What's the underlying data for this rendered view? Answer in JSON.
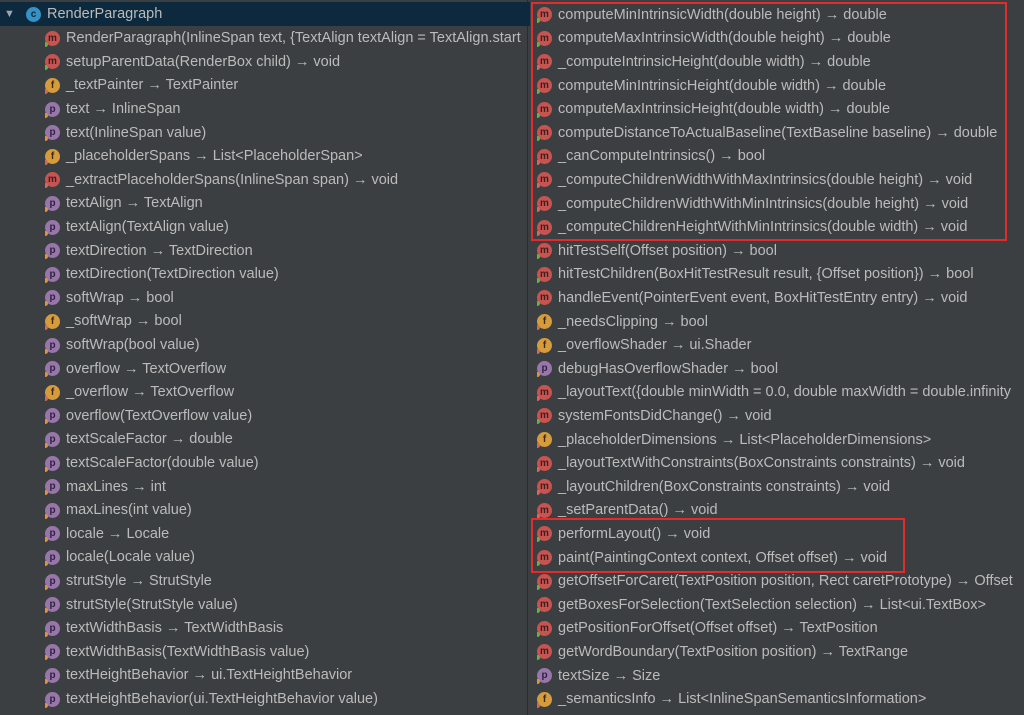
{
  "tree": {
    "class_name": "RenderParagraph",
    "left": [
      {
        "icon": "m",
        "text": "RenderParagraph(InlineSpan text, {TextAlign textAlign = TextAlign.start"
      },
      {
        "icon": "m",
        "text": "setupParentData(RenderBox child) → void"
      },
      {
        "icon": "f",
        "text": "_textPainter → TextPainter"
      },
      {
        "icon": "p",
        "text": "text → InlineSpan"
      },
      {
        "icon": "p",
        "text": "text(InlineSpan value)"
      },
      {
        "icon": "f",
        "text": "_placeholderSpans → List<PlaceholderSpan>"
      },
      {
        "icon": "m",
        "text": "_extractPlaceholderSpans(InlineSpan span) → void"
      },
      {
        "icon": "p",
        "text": "textAlign → TextAlign"
      },
      {
        "icon": "p",
        "text": "textAlign(TextAlign value)"
      },
      {
        "icon": "p",
        "text": "textDirection → TextDirection"
      },
      {
        "icon": "p",
        "text": "textDirection(TextDirection value)"
      },
      {
        "icon": "p",
        "text": "softWrap → bool"
      },
      {
        "icon": "f",
        "text": "_softWrap → bool"
      },
      {
        "icon": "p",
        "text": "softWrap(bool value)"
      },
      {
        "icon": "p",
        "text": "overflow → TextOverflow"
      },
      {
        "icon": "f",
        "text": "_overflow → TextOverflow"
      },
      {
        "icon": "p",
        "text": "overflow(TextOverflow value)"
      },
      {
        "icon": "p",
        "text": "textScaleFactor → double"
      },
      {
        "icon": "p",
        "text": "textScaleFactor(double value)"
      },
      {
        "icon": "p",
        "text": "maxLines → int"
      },
      {
        "icon": "p",
        "text": "maxLines(int value)"
      },
      {
        "icon": "p",
        "text": "locale → Locale"
      },
      {
        "icon": "p",
        "text": "locale(Locale value)"
      },
      {
        "icon": "p",
        "text": "strutStyle → StrutStyle"
      },
      {
        "icon": "p",
        "text": "strutStyle(StrutStyle value)"
      },
      {
        "icon": "p",
        "text": "textWidthBasis → TextWidthBasis"
      },
      {
        "icon": "p",
        "text": "textWidthBasis(TextWidthBasis value)"
      },
      {
        "icon": "p",
        "text": "textHeightBehavior → ui.TextHeightBehavior"
      },
      {
        "icon": "p",
        "text": "textHeightBehavior(ui.TextHeightBehavior value)"
      }
    ],
    "right": [
      {
        "icon": "m",
        "text": "computeMinIntrinsicWidth(double height) → double"
      },
      {
        "icon": "m",
        "text": "computeMaxIntrinsicWidth(double height) → double"
      },
      {
        "icon": "m",
        "text": "_computeIntrinsicHeight(double width) → double"
      },
      {
        "icon": "m",
        "text": "computeMinIntrinsicHeight(double width) → double"
      },
      {
        "icon": "m",
        "text": "computeMaxIntrinsicHeight(double width) → double"
      },
      {
        "icon": "m",
        "text": "computeDistanceToActualBaseline(TextBaseline baseline) → double"
      },
      {
        "icon": "m",
        "text": "_canComputeIntrinsics() → bool"
      },
      {
        "icon": "m",
        "text": "_computeChildrenWidthWithMaxIntrinsics(double height) → void"
      },
      {
        "icon": "m",
        "text": "_computeChildrenWidthWithMinIntrinsics(double height) → void"
      },
      {
        "icon": "m",
        "text": "_computeChildrenHeightWithMinIntrinsics(double width) → void"
      },
      {
        "icon": "m",
        "text": "hitTestSelf(Offset position) → bool"
      },
      {
        "icon": "m",
        "text": "hitTestChildren(BoxHitTestResult result, {Offset position}) → bool"
      },
      {
        "icon": "m",
        "text": "handleEvent(PointerEvent event, BoxHitTestEntry entry) → void"
      },
      {
        "icon": "f",
        "text": "_needsClipping → bool"
      },
      {
        "icon": "f",
        "text": "_overflowShader → ui.Shader"
      },
      {
        "icon": "p",
        "text": "debugHasOverflowShader → bool"
      },
      {
        "icon": "m",
        "text": "_layoutText({double minWidth = 0.0, double maxWidth = double.infinity"
      },
      {
        "icon": "m",
        "text": "systemFontsDidChange() → void"
      },
      {
        "icon": "f",
        "text": "_placeholderDimensions → List<PlaceholderDimensions>"
      },
      {
        "icon": "m",
        "text": "_layoutTextWithConstraints(BoxConstraints constraints) → void"
      },
      {
        "icon": "m",
        "text": "_layoutChildren(BoxConstraints constraints) → void"
      },
      {
        "icon": "m",
        "text": "_setParentData() → void"
      },
      {
        "icon": "m",
        "text": "performLayout() → void"
      },
      {
        "icon": "m",
        "text": "paint(PaintingContext context, Offset offset) → void"
      },
      {
        "icon": "m",
        "text": "getOffsetForCaret(TextPosition position, Rect caretPrototype) → Offset"
      },
      {
        "icon": "m",
        "text": "getBoxesForSelection(TextSelection selection) → List<ui.TextBox>"
      },
      {
        "icon": "m",
        "text": "getPositionForOffset(Offset offset) → TextPosition"
      },
      {
        "icon": "m",
        "text": "getWordBoundary(TextPosition position) → TextRange"
      },
      {
        "icon": "p",
        "text": "textSize → Size"
      },
      {
        "icon": "f",
        "text": "_semanticsInfo → List<InlineSpanSemanticsInformation>"
      }
    ]
  },
  "colors": {
    "background": "#3c3f41",
    "selection": "#0d293e",
    "highlight_box": "#e32b2b",
    "method_icon": "#c75450",
    "property_icon": "#9876aa",
    "field_icon": "#d69b3b",
    "class_icon": "#3592c4"
  }
}
